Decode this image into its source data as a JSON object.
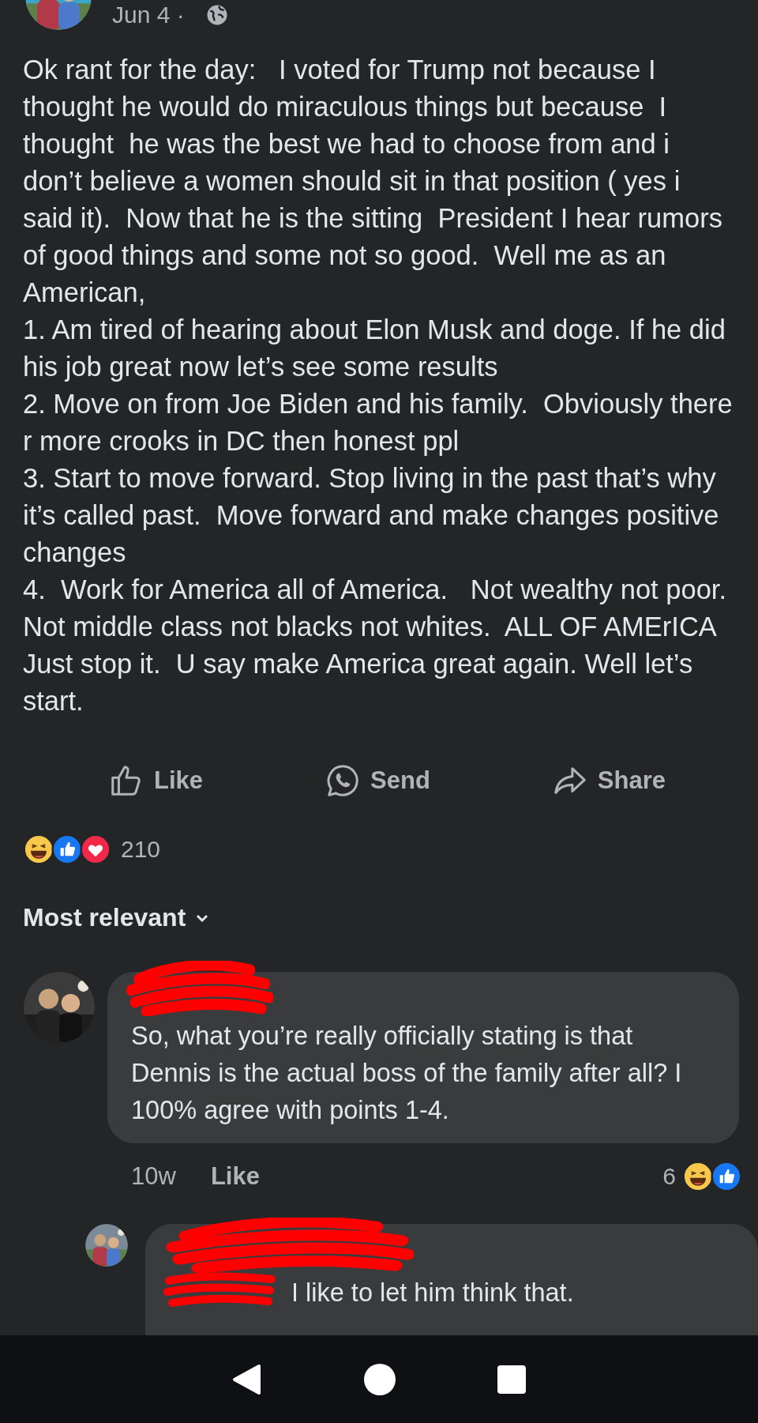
{
  "post": {
    "date": "Jun 4 ·",
    "paragraphs": [
      "Ok rant for the day:   I voted for Trump not because I thought he would do miraculous things but because  I thought  he was the best we had to choose from and i don’t believe a women should sit in that position ( yes i said it).  Now that he is the sitting  President I hear rumors of good things and some not so good.  Well me as an American,",
      "1. Am tired of hearing about Elon Musk and doge. If he did his job great now let’s see some results",
      "2. Move on from Joe Biden and his family.  Obviously there r more crooks in DC then honest ppl",
      "3. Start to move forward. Stop living in the past that’s why it’s called past.  Move forward and make changes positive changes",
      "4.  Work for America all of America.   Not wealthy not poor. Not middle class not blacks not whites.  ALL OF AMErICA",
      "Just stop it.  U say make America great again. Well let’s start."
    ]
  },
  "actions": [
    {
      "kind": "like",
      "label": "Like"
    },
    {
      "kind": "send",
      "label": "Send"
    },
    {
      "kind": "share",
      "label": "Share"
    }
  ],
  "reactions": {
    "kinds": [
      {
        "kind": "haha"
      },
      {
        "kind": "like"
      },
      {
        "kind": "love"
      }
    ],
    "count": "210"
  },
  "sort": {
    "label": "Most relevant"
  },
  "comments": [
    {
      "text": "So, what you’re really officially stating is that Dennis is the actual boss of the family after all? I 100% agree with points 1-4.",
      "time": "10w",
      "like": "Like",
      "reaction_count": "6",
      "reactions": [
        {
          "kind": "haha"
        },
        {
          "kind": "like"
        }
      ],
      "replies": [
        {
          "text": "I like to let him think that."
        }
      ]
    }
  ],
  "nav": [
    {
      "kind": "back"
    },
    {
      "kind": "home"
    },
    {
      "kind": "recents"
    }
  ]
}
